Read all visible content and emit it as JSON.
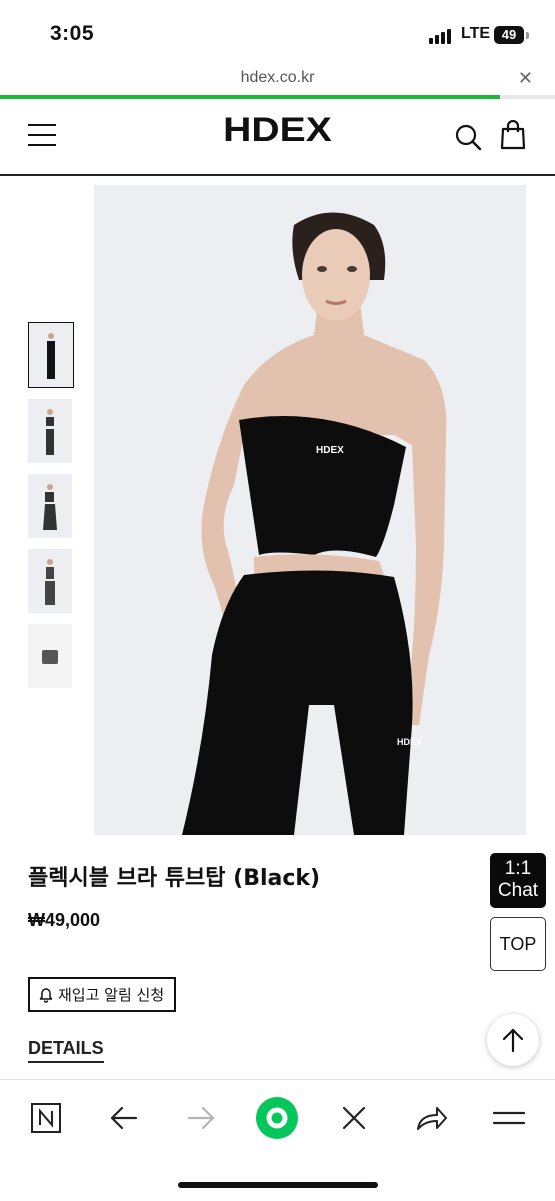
{
  "status_bar": {
    "time": "3:05",
    "network": "LTE",
    "battery": "49"
  },
  "browser": {
    "url": "hdex.co.kr",
    "load_progress_percent": 90
  },
  "header": {
    "logo": "HDEX"
  },
  "gallery": {
    "thumbnail_count": 5,
    "active_index": 0
  },
  "product": {
    "title": "플렉시블 브라 튜브탑 (Black)",
    "price": "₩49,000",
    "restock_label": "재입고 알림 신청",
    "details_label": "DETAILS"
  },
  "floating": {
    "chat_line1": "1:1",
    "chat_line2": "Chat",
    "top_label": "TOP"
  },
  "icons": [
    "menu-icon",
    "search-icon",
    "shopping-bag-icon",
    "bell-icon",
    "arrow-up-icon",
    "naver-n-icon",
    "back-arrow-icon",
    "forward-arrow-icon",
    "green-dot-icon",
    "close-icon",
    "share-icon",
    "hamburger-icon"
  ],
  "colors": {
    "progress": "#1fb53a",
    "accent_green": "#03c75a",
    "image_bg": "#eceef1"
  }
}
